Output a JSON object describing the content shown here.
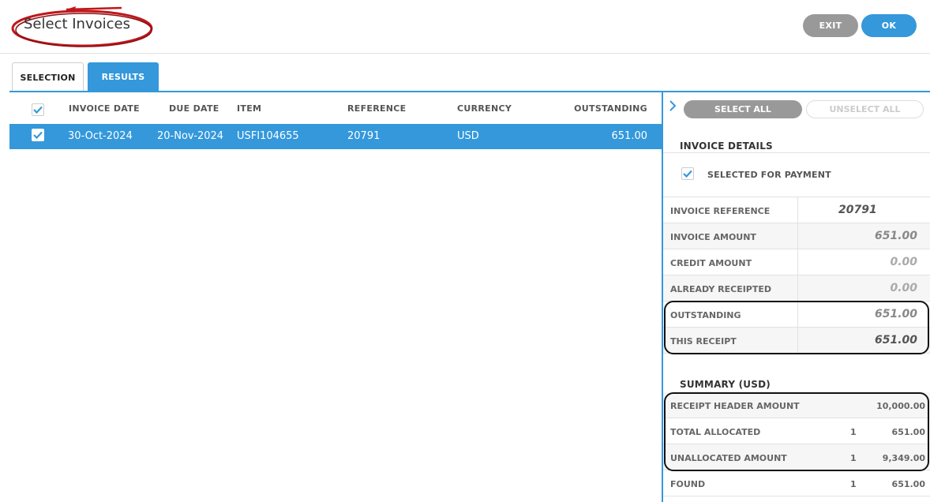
{
  "header": {
    "title": "Select Invoices",
    "exit_label": "EXIT",
    "ok_label": "OK"
  },
  "tabs": [
    {
      "label": "SELECTION",
      "active": false
    },
    {
      "label": "RESULTS",
      "active": true
    }
  ],
  "grid": {
    "columns": [
      "INVOICE DATE",
      "DUE DATE",
      "ITEM",
      "REFERENCE",
      "CURRENCY",
      "OUTSTANDING"
    ],
    "rows": [
      {
        "invoice_date": "30-Oct-2024",
        "due_date": "20-Nov-2024",
        "item": "USFI104655",
        "reference": "20791",
        "currency": "USD",
        "outstanding": "651.00",
        "checked": true
      }
    ]
  },
  "panel": {
    "select_all": "SELECT ALL",
    "unselect_all": "UNSELECT ALL",
    "invoice_details_title": "INVOICE DETAILS",
    "selected_for_payment": "SELECTED FOR PAYMENT",
    "details": [
      {
        "label": "INVOICE REFERENCE",
        "value": "20791"
      },
      {
        "label": "INVOICE AMOUNT",
        "value": "651.00"
      },
      {
        "label": "CREDIT AMOUNT",
        "value": "0.00"
      },
      {
        "label": "ALREADY RECEIPTED",
        "value": "0.00"
      },
      {
        "label": "OUTSTANDING",
        "value": "651.00"
      },
      {
        "label": "THIS RECEIPT",
        "value": "651.00"
      }
    ],
    "summary_title": "SUMMARY (USD)",
    "summary": [
      {
        "label": "RECEIPT HEADER AMOUNT",
        "count": "",
        "value": "10,000.00"
      },
      {
        "label": "TOTAL ALLOCATED",
        "count": "1",
        "value": "651.00"
      },
      {
        "label": "UNALLOCATED AMOUNT",
        "count": "1",
        "value": "9,349.00"
      },
      {
        "label": "FOUND",
        "count": "1",
        "value": "651.00"
      }
    ]
  },
  "colors": {
    "accent": "#3498db",
    "grey_button": "#999999",
    "annotation_red": "#c0161b"
  }
}
